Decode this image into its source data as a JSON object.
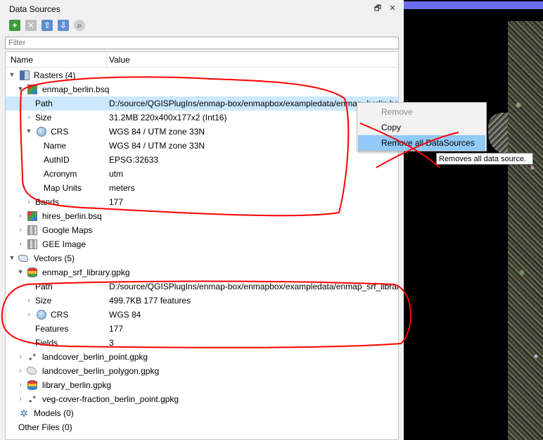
{
  "panel": {
    "title": "Data Sources",
    "float_label": "🗗",
    "close_label": "✕"
  },
  "toolbar": {
    "add": "+",
    "remove": "✕",
    "up": "⇧",
    "down": "⇩",
    "search": "⌕"
  },
  "filter": {
    "placeholder": "Filter"
  },
  "columns": {
    "name": "Name",
    "value": "Value"
  },
  "rasters": {
    "label": "Rasters (4)",
    "enmap": {
      "label": "enmap_berlin.bsq",
      "path_name": "Path",
      "path_value": "D:/source/QGISPlugIns/enmap-box/enmapbox/exampledata/enmap_berlin.bsq",
      "size_name": "Size",
      "size_value": "31.2MB 220x400x177x2 (Int16)",
      "crs_name": "CRS",
      "crs_value": "WGS 84 / UTM zone 33N",
      "name_name": "Name",
      "name_value": "WGS 84 / UTM zone 33N",
      "authid_name": "AuthID",
      "authid_value": "EPSG:32633",
      "acronym_name": "Acronym",
      "acronym_value": "utm",
      "units_name": "Map Units",
      "units_value": "meters",
      "bands_name": "Bands",
      "bands_value": "177"
    },
    "hires": "hires_berlin.bsq",
    "google": "Google Maps",
    "gee": "GEE Image"
  },
  "vectors": {
    "label": "Vectors (5)",
    "srf": {
      "label": "enmap_srf_library.gpkg",
      "path_name": "Path",
      "path_value": "D:/source/QGISPlugIns/enmap-box/enmapbox/exampledata/enmap_srf_library.gpkg",
      "size_name": "Size",
      "size_value": "499.7KB 177 features",
      "crs_name": "CRS",
      "crs_value": "WGS 84",
      "features_name": "Features",
      "features_value": "177",
      "fields_name": "Fields",
      "fields_value": "3"
    },
    "lc_point": "landcover_berlin_point.gpkg",
    "lc_polygon": "landcover_berlin_polygon.gpkg",
    "library": "library_berlin.gpkg",
    "veg": "veg-cover-fraction_berlin_point.gpkg"
  },
  "models": "Models (0)",
  "other": "Other Files (0)",
  "context_menu": {
    "remove": "Remove",
    "copy": "Copy",
    "remove_all": "Remove all DataSources"
  },
  "tooltip": "Removes all data source.",
  "colors": {
    "selection": "#cce8ff",
    "menu_highlight": "#91c9f7",
    "annotation": "#ff0000"
  }
}
